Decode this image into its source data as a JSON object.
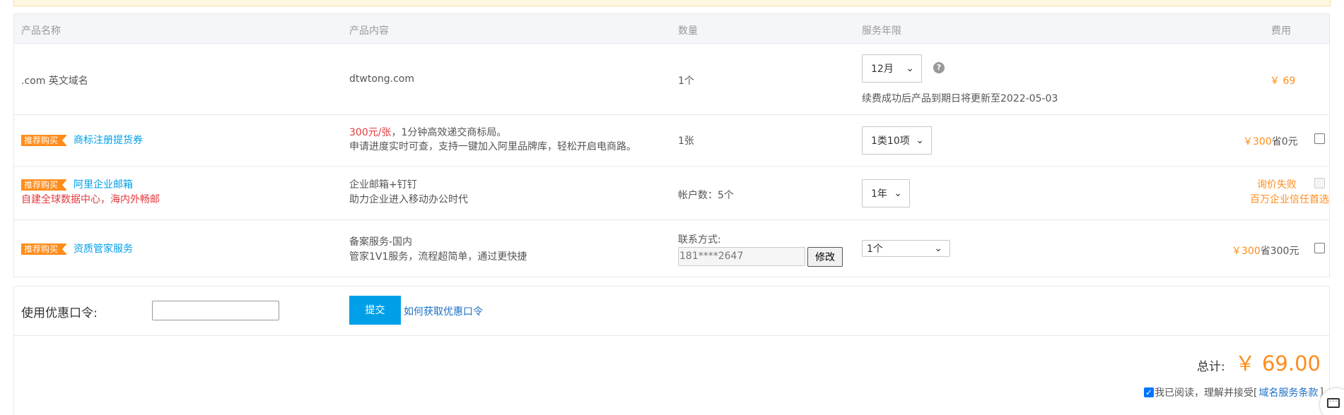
{
  "table": {
    "headers": {
      "name": "产品名称",
      "content": "产品内容",
      "quantity": "数量",
      "period": "服务年限",
      "fee": "费用"
    },
    "rows": [
      {
        "name": ".com 英文域名",
        "content": "dtwtong.com",
        "quantity": "1个",
        "period_select": "12月",
        "help_icon": "?",
        "renew_note": "续费成功后产品到期日将更新至2022-05-03",
        "fee": "￥ 69"
      },
      {
        "badge": "推荐购买",
        "name": "商标注册提货券",
        "content_highlight": "300元/张",
        "content_line1": "，1分钟高效递交商标局。",
        "content_line2": "申请进度实时可查，支持一键加入阿里品牌库，轻松开启电商路。",
        "quantity": "1张",
        "period_select": "1类10项",
        "fee_price": "￥300",
        "fee_save": "省0元"
      },
      {
        "badge": "推荐购买",
        "name": "阿里企业邮箱",
        "name_sub": "自建全球数据中心，海内外畅邮",
        "content_line1": "企业邮箱+钉钉",
        "content_line2": "助力企业进入移动办公时代",
        "quantity": "帐户数：5个",
        "period_select": "1年",
        "fee_line1": "询价失败",
        "fee_line2": "百万企业信任首选"
      },
      {
        "badge": "推荐购买",
        "name": "资质管家服务",
        "content_line1": "备案服务-国内",
        "content_line2": "管家1V1服务，流程超简单，通过更快捷",
        "contact_label": "联系方式:",
        "contact_value": "181****2647",
        "modify_label": "修改",
        "period_select": "1个",
        "fee_price": "￥300",
        "fee_save": "省300元"
      }
    ]
  },
  "coupon": {
    "label": "使用优惠口令:",
    "input_value": "",
    "submit_label": "提交",
    "how_link": "如何获取优惠口令"
  },
  "summary": {
    "total_label": "总计:",
    "total_value": "￥ 69.00",
    "agree_text": "我已阅读，理解并接受[",
    "agree_link": "域名服务条款",
    "agree_end": "]"
  },
  "icons": {
    "chevron": "chevron-down-icon",
    "help": "question-circle-icon",
    "chat": "chat-bubble-icon"
  },
  "colors": {
    "accent": "#00a0e9",
    "price": "#ff8c1a",
    "warning_red": "#e4393c",
    "badge": "#ff8c1a"
  }
}
